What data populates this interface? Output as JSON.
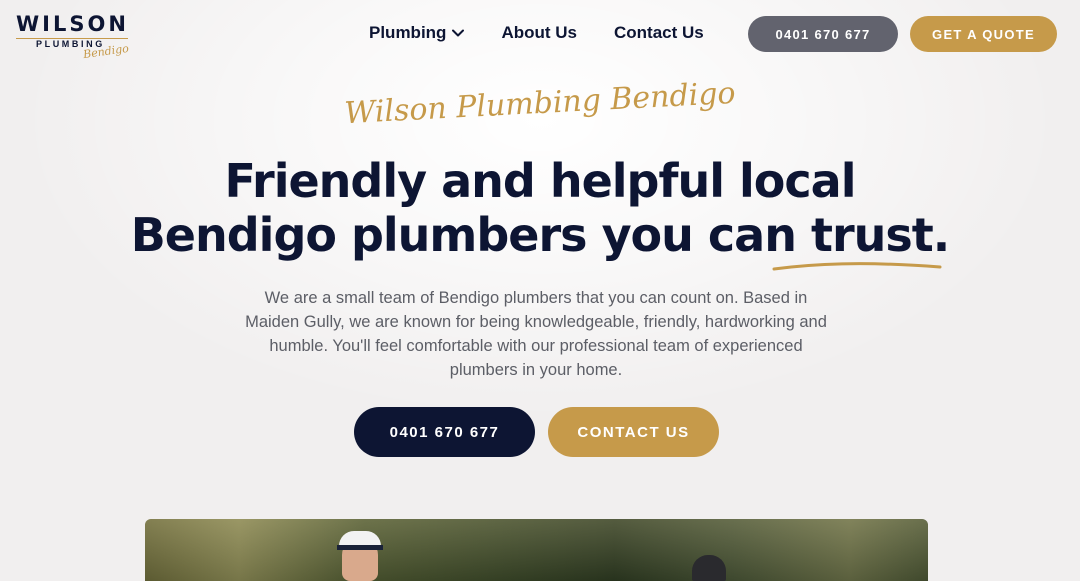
{
  "header": {
    "logo": {
      "word": "WILSON",
      "sub": "PLUMBING",
      "script": "Bendigo"
    },
    "nav": [
      {
        "label": "Plumbing",
        "has_dropdown": true
      },
      {
        "label": "About Us"
      },
      {
        "label": "Contact Us"
      }
    ],
    "phone_button": "0401 670 677",
    "quote_button": "GET A QUOTE"
  },
  "hero": {
    "script_title": "Wilson Plumbing Bendigo",
    "headline_line1": "Friendly and helpful local",
    "headline_line2": "Bendigo plumbers you can trust.",
    "intro": "We are a small team of Bendigo plumbers that you can count on. Based in Maiden Gully, we are known for being knowledgeable, friendly, hardworking and humble. You'll feel comfortable with our professional team of experienced plumbers in your home.",
    "phone_button": "0401 670 677",
    "contact_button": "CONTACT US"
  },
  "photo": {
    "alt_icon": "team-photo"
  },
  "colors": {
    "navy": "#0d1533",
    "gold": "#c69a4a",
    "grey_button": "#62636e",
    "background": "#f1efef"
  }
}
